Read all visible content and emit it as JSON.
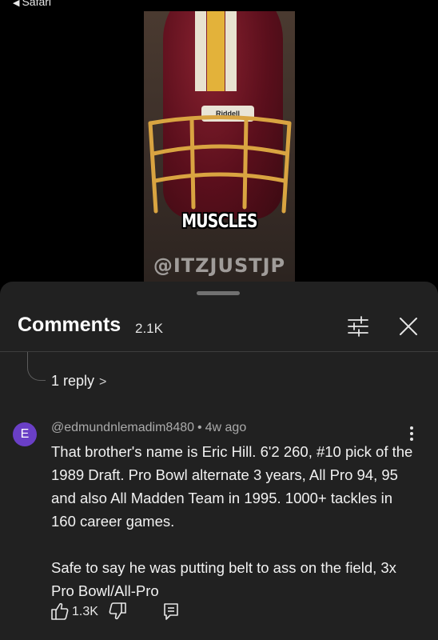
{
  "status_bar": {
    "back_app": "Safari"
  },
  "video": {
    "helmet_brand": "Riddell",
    "caption": "MUSCLES",
    "watermark": "@ITZJUSTJP"
  },
  "comments_panel": {
    "title": "Comments",
    "count": "2.1K",
    "icons": {
      "filter": "filter-sliders-icon",
      "close": "close-icon"
    }
  },
  "previous_thread": {
    "replies_label": "1 reply"
  },
  "comment": {
    "avatar_letter": "E",
    "avatar_color": "#6a3fc6",
    "author": "@edmundnlemadim8480",
    "time": "4w ago",
    "paragraphs": [
      "That brother's name is Eric Hill. 6'2 260, #10 pick of the 1989 Draft. Pro Bowl alternate 3 years, All Pro 94, 95 and also All Madden Team in 1995. 1000+ tackles in 160 career games.",
      "Safe to say he was putting belt to ass on the field, 3x Pro Bowl/All-Pro"
    ],
    "likes": "1.3K"
  }
}
